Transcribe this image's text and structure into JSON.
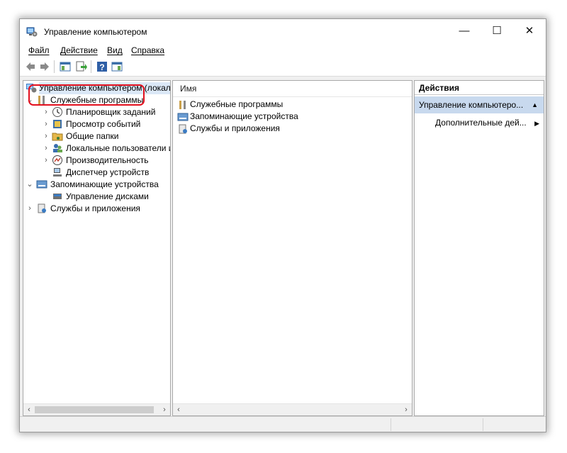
{
  "window": {
    "title": "Управление компьютером",
    "minimize": "—",
    "maximize": "☐",
    "close": "✕"
  },
  "menu": [
    {
      "label": "Файл"
    },
    {
      "label": "Действие"
    },
    {
      "label": "Вид"
    },
    {
      "label": "Справка"
    }
  ],
  "tree": {
    "root": "Управление компьютером (локал",
    "items": [
      {
        "label": "Служебные программы"
      },
      {
        "label": "Планировщик заданий"
      },
      {
        "label": "Просмотр событий"
      },
      {
        "label": "Общие папки"
      },
      {
        "label": "Локальные пользователи и"
      },
      {
        "label": "Производительность"
      },
      {
        "label": "Диспетчер устройств"
      },
      {
        "label": "Запоминающие устройства"
      },
      {
        "label": "Управление дисками"
      },
      {
        "label": "Службы и приложения"
      }
    ]
  },
  "list": {
    "header": "Имя",
    "items": [
      {
        "label": "Служебные программы"
      },
      {
        "label": "Запоминающие устройства"
      },
      {
        "label": "Службы и приложения"
      }
    ]
  },
  "actions": {
    "header": "Действия",
    "selected": "Управление компьютеро...",
    "more": "Дополнительные дей..."
  },
  "colors": {
    "highlight": "#e3101e",
    "selection": "#c8d9ee"
  }
}
